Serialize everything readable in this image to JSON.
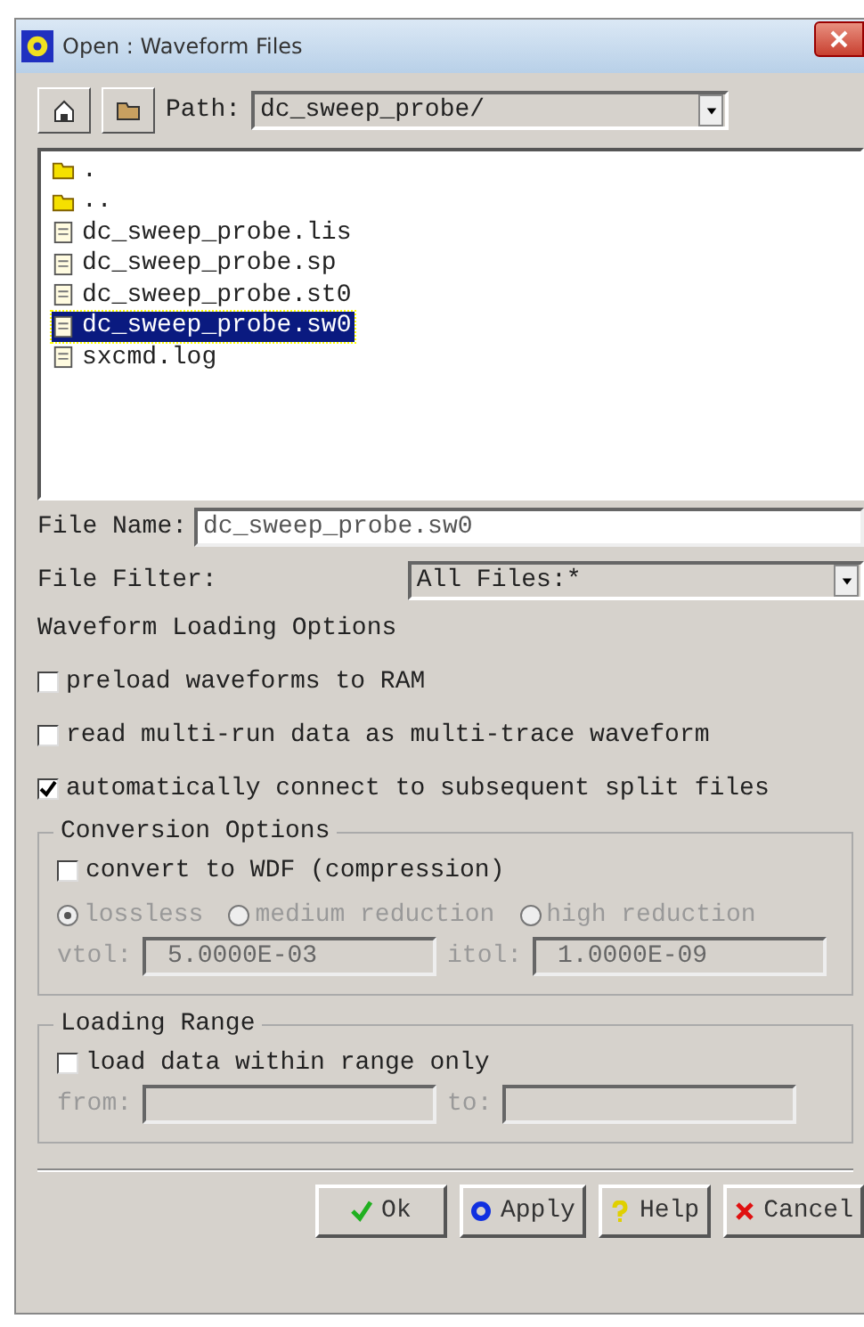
{
  "window": {
    "title": "Open : Waveform Files"
  },
  "toolbar": {
    "path_label": "Path:",
    "path": "dc_sweep_probe/"
  },
  "files": [
    {
      "name": ".",
      "kind": "folder",
      "selected": false
    },
    {
      "name": "..",
      "kind": "folder",
      "selected": false
    },
    {
      "name": "dc_sweep_probe.lis",
      "kind": "file",
      "selected": false
    },
    {
      "name": "dc_sweep_probe.sp",
      "kind": "file",
      "selected": false
    },
    {
      "name": "dc_sweep_probe.st0",
      "kind": "file",
      "selected": false
    },
    {
      "name": "dc_sweep_probe.sw0",
      "kind": "file",
      "selected": true
    },
    {
      "name": "sxcmd.log",
      "kind": "file",
      "selected": false
    }
  ],
  "file_name": {
    "label": "File Name:",
    "value": "dc_sweep_probe.sw0"
  },
  "file_filter": {
    "label": "File Filter:",
    "value": "All Files:*"
  },
  "loading_options": {
    "heading": "Waveform Loading Options",
    "options": [
      {
        "label": "preload waveforms to RAM",
        "checked": false
      },
      {
        "label": "read multi-run data as multi-trace waveform",
        "checked": false
      },
      {
        "label": "automatically connect to subsequent split files",
        "checked": true
      }
    ]
  },
  "conversion": {
    "title": "Conversion Options",
    "disabled": true,
    "convert": {
      "label": "convert to WDF (compression)",
      "checked": false
    },
    "modes": [
      {
        "label": "lossless",
        "selected": true
      },
      {
        "label": "medium reduction",
        "selected": false
      },
      {
        "label": "high reduction",
        "selected": false
      }
    ],
    "vtol": {
      "label": "vtol:",
      "value": "5.0000E-03"
    },
    "itol": {
      "label": "itol:",
      "value": "1.0000E-09"
    }
  },
  "loading_range": {
    "title": "Loading Range",
    "disabled": true,
    "checkbox": {
      "label": "load data within range only",
      "checked": false
    },
    "from": {
      "label": "from:"
    },
    "to": {
      "label": "to:"
    }
  },
  "buttons": [
    {
      "label": "Ok",
      "kind": "ok"
    },
    {
      "label": "Apply",
      "kind": "apply"
    },
    {
      "label": "Help",
      "kind": "help"
    },
    {
      "label": "Cancel",
      "kind": "cancel"
    }
  ]
}
